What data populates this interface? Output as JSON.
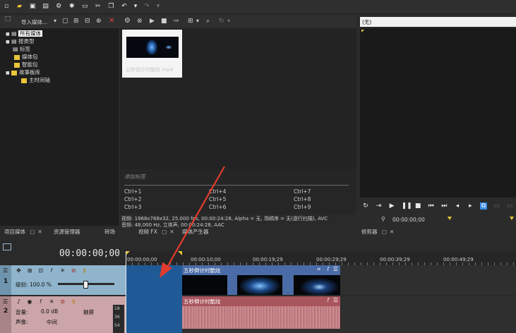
{
  "toolbar": {
    "icons": [
      "new-icon",
      "open-icon",
      "save-icon",
      "save-as-icon",
      "settings-icon",
      "properties-icon",
      "render-icon",
      "cut-icon",
      "copy-icon",
      "undo-icon",
      "undo-dropdown-icon",
      "redo-icon",
      "redo-dropdown-icon"
    ]
  },
  "media_toolbar": {
    "import_label": "导入媒体..."
  },
  "media_tree": {
    "items": [
      {
        "label": "所有媒体",
        "selected": true
      },
      {
        "label": "按类型",
        "selected": false
      },
      {
        "label": "标签",
        "selected": false
      },
      {
        "label": "媒体包",
        "selected": false
      },
      {
        "label": "智能包",
        "selected": false
      },
      {
        "label": "故事板库",
        "selected": false
      },
      {
        "label": "主时间轴",
        "selected": false
      }
    ]
  },
  "media_thumb": {
    "filename": "五秒倒计时酷炫.mp4"
  },
  "tag_panel": {
    "placeholder": "添加标签",
    "shortcuts": [
      "Ctrl+1",
      "Ctrl+4",
      "Ctrl+7",
      "Ctrl+2",
      "Ctrl+5",
      "Ctrl+8",
      "Ctrl+3",
      "Ctrl+6",
      "Ctrl+9"
    ]
  },
  "media_info": {
    "video_line": "视频: 1968x768x32, 25.000 fps, 00:00:24:28, Alpha = 无, 场顺序 = 无(逐行扫描), AVC",
    "audio_line": "音频: 48,000 Hz, 立体声, 00:00:24:28, AAC"
  },
  "bottom_tabs": {
    "project_media": "项目媒体",
    "explorer": "资源管理器",
    "transitions": "转场",
    "video_fx": "视频 FX",
    "media_generators": "媒体产生器",
    "preview": "修剪器"
  },
  "preview": {
    "dropdown_value": "(无)",
    "timecode": "00:00:00;00"
  },
  "timeline": {
    "current_time": "00:00:00;00",
    "ruler_labels": [
      "00:00:00;00",
      "00:00:10;00",
      "00:00:19;29",
      "00:00:29;29",
      "00:00:39;29",
      "00:00:49;29"
    ],
    "video_track": {
      "number": "1",
      "level_label": "级别: 100.0 %",
      "clip_name": "五秒倒计时酷炫"
    },
    "audio_track": {
      "number": "2",
      "volume_label": "音量:",
      "volume_value": "0.0 dB",
      "pan_label": "声像:",
      "pan_value": "中间",
      "mode_label": "触摸",
      "clip_name": "五秒倒计时酷炫",
      "meter_scale": [
        "18",
        "36",
        "54"
      ]
    }
  },
  "colors": {
    "video_track_header": "#8fb4cc",
    "audio_track_header": "#cba5a8",
    "video_clip": "#4a6ba6",
    "audio_clip": "#a8555c",
    "drop_zone": "#1f5a96",
    "arrow": "#e23b2e"
  }
}
